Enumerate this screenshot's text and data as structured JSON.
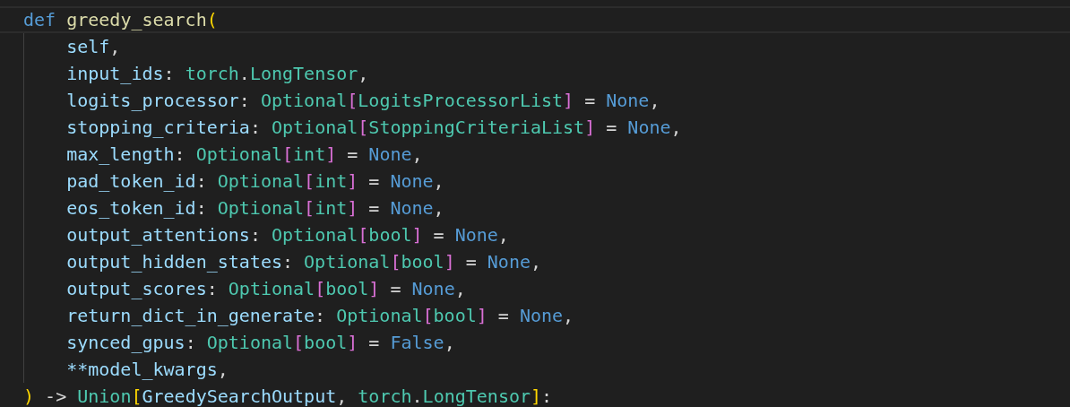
{
  "editor": {
    "lines": [
      {
        "current": true,
        "tokens": [
          {
            "text": "def ",
            "kind": "keyword"
          },
          {
            "text": "greedy_search",
            "kind": "function"
          },
          {
            "text": "(",
            "kind": "bracket1"
          }
        ]
      },
      {
        "current": false,
        "tokens": [
          {
            "text": "    self",
            "kind": "param"
          },
          {
            "text": ",",
            "kind": "plain"
          }
        ]
      },
      {
        "current": false,
        "tokens": [
          {
            "text": "    input_ids",
            "kind": "param"
          },
          {
            "text": ": ",
            "kind": "plain"
          },
          {
            "text": "torch",
            "kind": "type"
          },
          {
            "text": ".",
            "kind": "plain"
          },
          {
            "text": "LongTensor",
            "kind": "type"
          },
          {
            "text": ",",
            "kind": "plain"
          }
        ]
      },
      {
        "current": false,
        "tokens": [
          {
            "text": "    logits_processor",
            "kind": "param"
          },
          {
            "text": ": ",
            "kind": "plain"
          },
          {
            "text": "Optional",
            "kind": "type"
          },
          {
            "text": "[",
            "kind": "bracket2"
          },
          {
            "text": "LogitsProcessorList",
            "kind": "type"
          },
          {
            "text": "]",
            "kind": "bracket2"
          },
          {
            "text": " = ",
            "kind": "plain"
          },
          {
            "text": "None",
            "kind": "constant"
          },
          {
            "text": ",",
            "kind": "plain"
          }
        ]
      },
      {
        "current": false,
        "tokens": [
          {
            "text": "    stopping_criteria",
            "kind": "param"
          },
          {
            "text": ": ",
            "kind": "plain"
          },
          {
            "text": "Optional",
            "kind": "type"
          },
          {
            "text": "[",
            "kind": "bracket2"
          },
          {
            "text": "StoppingCriteriaList",
            "kind": "type"
          },
          {
            "text": "]",
            "kind": "bracket2"
          },
          {
            "text": " = ",
            "kind": "plain"
          },
          {
            "text": "None",
            "kind": "constant"
          },
          {
            "text": ",",
            "kind": "plain"
          }
        ]
      },
      {
        "current": false,
        "tokens": [
          {
            "text": "    max_length",
            "kind": "param"
          },
          {
            "text": ": ",
            "kind": "plain"
          },
          {
            "text": "Optional",
            "kind": "type"
          },
          {
            "text": "[",
            "kind": "bracket2"
          },
          {
            "text": "int",
            "kind": "type"
          },
          {
            "text": "]",
            "kind": "bracket2"
          },
          {
            "text": " = ",
            "kind": "plain"
          },
          {
            "text": "None",
            "kind": "constant"
          },
          {
            "text": ",",
            "kind": "plain"
          }
        ]
      },
      {
        "current": false,
        "tokens": [
          {
            "text": "    pad_token_id",
            "kind": "param"
          },
          {
            "text": ": ",
            "kind": "plain"
          },
          {
            "text": "Optional",
            "kind": "type"
          },
          {
            "text": "[",
            "kind": "bracket2"
          },
          {
            "text": "int",
            "kind": "type"
          },
          {
            "text": "]",
            "kind": "bracket2"
          },
          {
            "text": " = ",
            "kind": "plain"
          },
          {
            "text": "None",
            "kind": "constant"
          },
          {
            "text": ",",
            "kind": "plain"
          }
        ]
      },
      {
        "current": false,
        "tokens": [
          {
            "text": "    eos_token_id",
            "kind": "param"
          },
          {
            "text": ": ",
            "kind": "plain"
          },
          {
            "text": "Optional",
            "kind": "type"
          },
          {
            "text": "[",
            "kind": "bracket2"
          },
          {
            "text": "int",
            "kind": "type"
          },
          {
            "text": "]",
            "kind": "bracket2"
          },
          {
            "text": " = ",
            "kind": "plain"
          },
          {
            "text": "None",
            "kind": "constant"
          },
          {
            "text": ",",
            "kind": "plain"
          }
        ]
      },
      {
        "current": false,
        "tokens": [
          {
            "text": "    output_attentions",
            "kind": "param"
          },
          {
            "text": ": ",
            "kind": "plain"
          },
          {
            "text": "Optional",
            "kind": "type"
          },
          {
            "text": "[",
            "kind": "bracket2"
          },
          {
            "text": "bool",
            "kind": "type"
          },
          {
            "text": "]",
            "kind": "bracket2"
          },
          {
            "text": " = ",
            "kind": "plain"
          },
          {
            "text": "None",
            "kind": "constant"
          },
          {
            "text": ",",
            "kind": "plain"
          }
        ]
      },
      {
        "current": false,
        "tokens": [
          {
            "text": "    output_hidden_states",
            "kind": "param"
          },
          {
            "text": ": ",
            "kind": "plain"
          },
          {
            "text": "Optional",
            "kind": "type"
          },
          {
            "text": "[",
            "kind": "bracket2"
          },
          {
            "text": "bool",
            "kind": "type"
          },
          {
            "text": "]",
            "kind": "bracket2"
          },
          {
            "text": " = ",
            "kind": "plain"
          },
          {
            "text": "None",
            "kind": "constant"
          },
          {
            "text": ",",
            "kind": "plain"
          }
        ]
      },
      {
        "current": false,
        "tokens": [
          {
            "text": "    output_scores",
            "kind": "param"
          },
          {
            "text": ": ",
            "kind": "plain"
          },
          {
            "text": "Optional",
            "kind": "type"
          },
          {
            "text": "[",
            "kind": "bracket2"
          },
          {
            "text": "bool",
            "kind": "type"
          },
          {
            "text": "]",
            "kind": "bracket2"
          },
          {
            "text": " = ",
            "kind": "plain"
          },
          {
            "text": "None",
            "kind": "constant"
          },
          {
            "text": ",",
            "kind": "plain"
          }
        ]
      },
      {
        "current": false,
        "tokens": [
          {
            "text": "    return_dict_in_generate",
            "kind": "param"
          },
          {
            "text": ": ",
            "kind": "plain"
          },
          {
            "text": "Optional",
            "kind": "type"
          },
          {
            "text": "[",
            "kind": "bracket2"
          },
          {
            "text": "bool",
            "kind": "type"
          },
          {
            "text": "]",
            "kind": "bracket2"
          },
          {
            "text": " = ",
            "kind": "plain"
          },
          {
            "text": "None",
            "kind": "constant"
          },
          {
            "text": ",",
            "kind": "plain"
          }
        ]
      },
      {
        "current": false,
        "tokens": [
          {
            "text": "    synced_gpus",
            "kind": "param"
          },
          {
            "text": ": ",
            "kind": "plain"
          },
          {
            "text": "Optional",
            "kind": "type"
          },
          {
            "text": "[",
            "kind": "bracket2"
          },
          {
            "text": "bool",
            "kind": "type"
          },
          {
            "text": "]",
            "kind": "bracket2"
          },
          {
            "text": " = ",
            "kind": "plain"
          },
          {
            "text": "False",
            "kind": "constant"
          },
          {
            "text": ",",
            "kind": "plain"
          }
        ]
      },
      {
        "current": false,
        "tokens": [
          {
            "text": "    **model_kwargs",
            "kind": "param"
          },
          {
            "text": ",",
            "kind": "plain"
          }
        ]
      },
      {
        "current": false,
        "tokens": [
          {
            "text": ")",
            "kind": "bracket1"
          },
          {
            "text": " -> ",
            "kind": "plain"
          },
          {
            "text": "Union",
            "kind": "type"
          },
          {
            "text": "[",
            "kind": "bracket1"
          },
          {
            "text": "GreedySearchOutput",
            "kind": "param"
          },
          {
            "text": ", ",
            "kind": "plain"
          },
          {
            "text": "torch",
            "kind": "type"
          },
          {
            "text": ".",
            "kind": "plain"
          },
          {
            "text": "LongTensor",
            "kind": "type"
          },
          {
            "text": "]",
            "kind": "bracket1"
          },
          {
            "text": ":",
            "kind": "plain"
          }
        ]
      }
    ]
  }
}
